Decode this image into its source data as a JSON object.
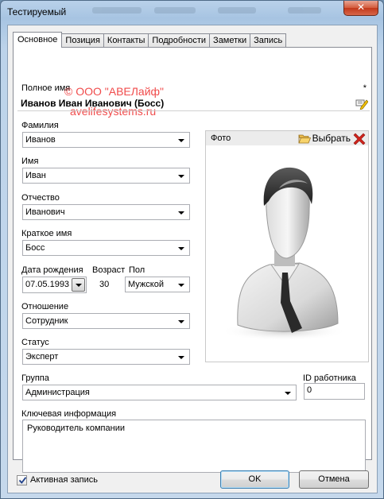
{
  "window": {
    "title": "Тестируемый",
    "close_glyph": "✕"
  },
  "tabs": [
    "Основное",
    "Позиция",
    "Контакты",
    "Подробности",
    "Заметки",
    "Запись"
  ],
  "main": {
    "fullname_label": "Полное имя",
    "required_marker": "*",
    "fullname_value": "Иванов Иван Иванович (Босс)",
    "watermark_line1": "© ООО \"АВЕЛайф\"",
    "watermark_line2": "avelifesystems.ru",
    "surname_label": "Фамилия",
    "surname_value": "Иванов",
    "name_label": "Имя",
    "name_value": "Иван",
    "patronymic_label": "Отчество",
    "patronymic_value": "Иванович",
    "short_name_label": "Краткое имя",
    "short_name_value": "Босс",
    "birth_label": "Дата рождения",
    "birth_value": "07.05.1993",
    "age_label": "Возраст",
    "age_value": "30",
    "gender_label": "Пол",
    "gender_value": "Мужской",
    "relation_label": "Отношение",
    "relation_value": "Сотрудник",
    "status_label": "Статус",
    "status_value": "Эксперт",
    "group_label": "Группа",
    "group_value": "Администрация",
    "employee_id_label": "ID работника",
    "employee_id_value": "0",
    "key_info_label": "Ключевая информация",
    "key_info_value": "Руководитель компании"
  },
  "photo": {
    "title": "Фото",
    "pick_label": "Выбрать",
    "pick_icon": "folder-open-icon",
    "delete_icon": "close-x-icon",
    "image": "person-avatar"
  },
  "footer": {
    "active_label": "Активная запись",
    "active_checked": true,
    "ok_label": "OK",
    "cancel_label": "Отмена"
  },
  "colors": {
    "watermark": "#ee2b2b",
    "delete_icon": "#d0231b",
    "titlebar": "#b9d1ea",
    "close_button": "#c2381a"
  }
}
